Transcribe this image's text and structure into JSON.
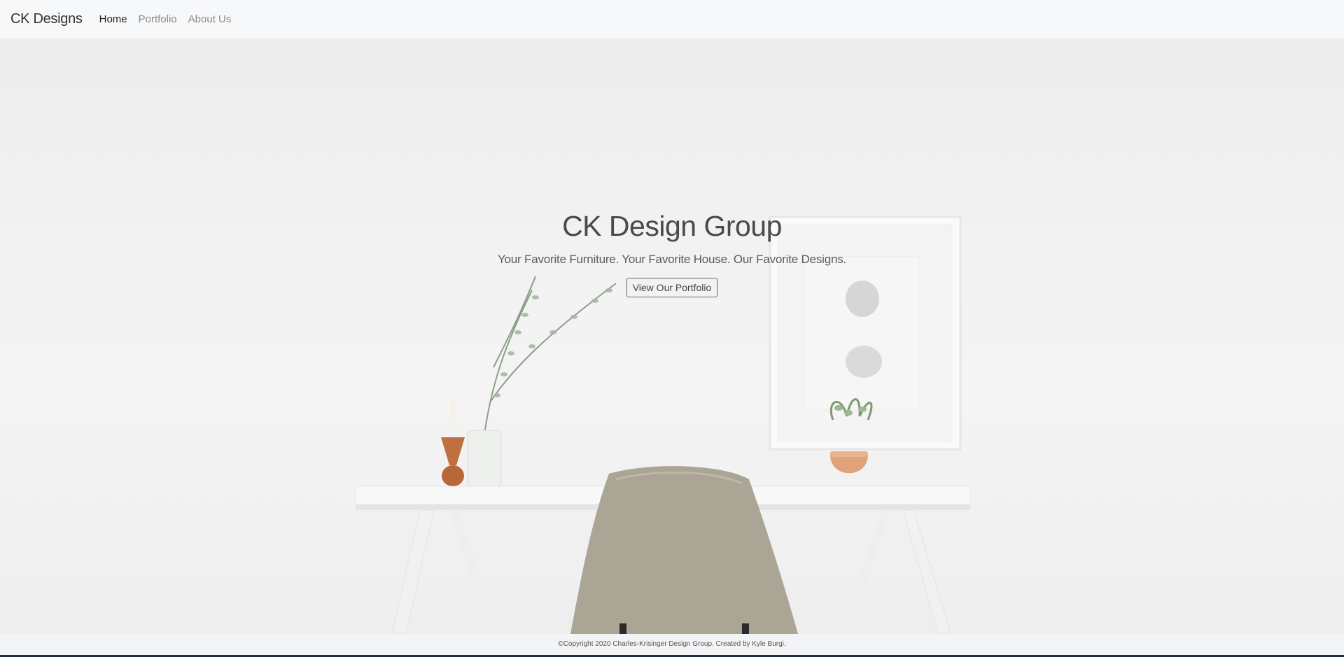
{
  "navbar": {
    "brand": "CK Designs",
    "links": [
      {
        "label": "Home",
        "active": true
      },
      {
        "label": "Portfolio",
        "active": false
      },
      {
        "label": "About Us",
        "active": false
      }
    ]
  },
  "hero": {
    "title": "CK Design Group",
    "subtitle": "Your Favorite Furniture. Your Favorite House. Our Favorite Designs.",
    "button_label": "View Our Portfolio"
  },
  "footer": {
    "text": "©Copyright 2020 Charles-Krisinger Design Group. Created by Kyle Burgi."
  },
  "colors": {
    "chair": "#aaa595",
    "vase": "#c07040",
    "pot": "#e0a27a",
    "bottom_bar": "#1f2a44"
  }
}
